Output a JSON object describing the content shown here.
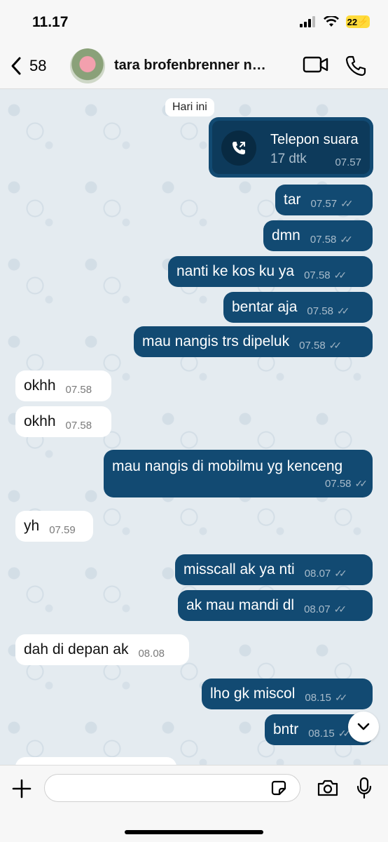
{
  "status_bar": {
    "time": "11.17",
    "battery": "22"
  },
  "header": {
    "back_count": "58",
    "contact_name": "tara brofenbrenner ng..."
  },
  "chat": {
    "date_chip": "Hari ini",
    "call": {
      "title": "Telepon suara",
      "duration": "17 dtk",
      "time": "07.57"
    },
    "messages": [
      {
        "dir": "out",
        "text": "tar",
        "time": "07.57"
      },
      {
        "dir": "out",
        "text": "dmn",
        "time": "07.58"
      },
      {
        "dir": "out",
        "text": "nanti ke kos ku ya",
        "time": "07.58"
      },
      {
        "dir": "out",
        "text": "bentar aja",
        "time": "07.58"
      },
      {
        "dir": "out",
        "text": "mau nangis trs dipeluk",
        "time": "07.58"
      },
      {
        "dir": "in",
        "text": "okhh",
        "time": "07.58"
      },
      {
        "dir": "in",
        "text": "okhh",
        "time": "07.58"
      },
      {
        "dir": "out",
        "text": "mau nangis di mobilmu yg kenceng",
        "time": "07.58"
      },
      {
        "dir": "in",
        "text": "yh",
        "time": "07.59"
      },
      {
        "dir": "out",
        "text": "misscall ak ya nti",
        "time": "08.07"
      },
      {
        "dir": "out",
        "text": "ak mau mandi dl",
        "time": "08.07"
      },
      {
        "dir": "in",
        "text": "dah di depan ak",
        "time": "08.08"
      },
      {
        "dir": "out",
        "text": "lho gk miscol",
        "time": "08.15"
      },
      {
        "dir": "out",
        "text": "bntr",
        "time": "08.15"
      }
    ]
  },
  "composer": {
    "placeholder": ""
  },
  "colors": {
    "outgoing_bubble": "#124a72",
    "incoming_bubble": "#ffffff",
    "chat_background": "#e4ebf0"
  },
  "icons": [
    "back-icon",
    "video-call-icon",
    "phone-icon",
    "outgoing-call-icon",
    "chevron-down-icon",
    "plus-icon",
    "sticker-icon",
    "camera-icon",
    "mic-icon"
  ]
}
